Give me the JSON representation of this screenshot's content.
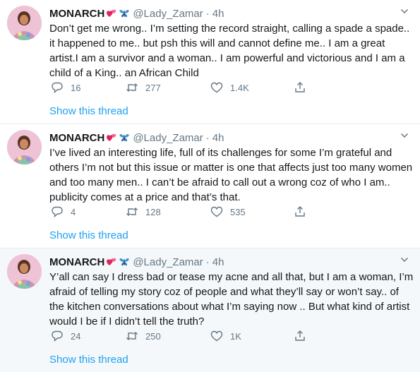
{
  "tweets": [
    {
      "name": "MONARCH",
      "handle": "@Lady_Zamar",
      "separator": "·",
      "time": "4h",
      "text": "Don’t get me wrong.. I’m setting the record straight, calling a spade a spade.. it happened to me.. but psh this will and cannot define me.. I am a great artist.I am a survivor and a woman.. I am powerful and victorious and I am a child of a King.. an African Child",
      "replies": "16",
      "retweets": "277",
      "likes": "1.4K",
      "thread_link": "Show this thread"
    },
    {
      "name": "MONARCH",
      "handle": "@Lady_Zamar",
      "separator": "·",
      "time": "4h",
      "text": "I’ve lived an interesting life, full of its challenges for some I’m grateful and others I’m not but this issue or matter is one that affects just too many women and too many men.. I can’t be afraid to call out a wrong coz of who I am.. publicity comes at a price and that’s that.",
      "replies": "4",
      "retweets": "128",
      "likes": "535",
      "thread_link": "Show this thread"
    },
    {
      "name": "MONARCH",
      "handle": "@Lady_Zamar",
      "separator": "·",
      "time": "4h",
      "text": "Y’all can say I dress bad or tease my acne and all that, but I am a woman, I’m afraid of telling my story coz of people and what they’ll say or won’t say.. of the kitchen conversations about what I’m saying now .. But what kind of artist would I be if I didn’t tell the truth?",
      "replies": "24",
      "retweets": "250",
      "likes": "1K",
      "thread_link": "Show this thread"
    }
  ],
  "colors": {
    "link": "#1da1f2",
    "muted": "#657786",
    "text": "#14171a",
    "divider": "#e6ecf0",
    "highlight_bg": "#f5f8fa",
    "heart_emoji": "#e0245e",
    "butterfly_emoji": "#1d6fb8"
  },
  "icons": {
    "emoji_1": "two-hearts-emoji",
    "emoji_2": "butterfly-emoji",
    "reply": "reply-icon",
    "retweet": "retweet-icon",
    "like": "heart-icon",
    "share": "share-icon",
    "menu": "chevron-down-icon"
  }
}
